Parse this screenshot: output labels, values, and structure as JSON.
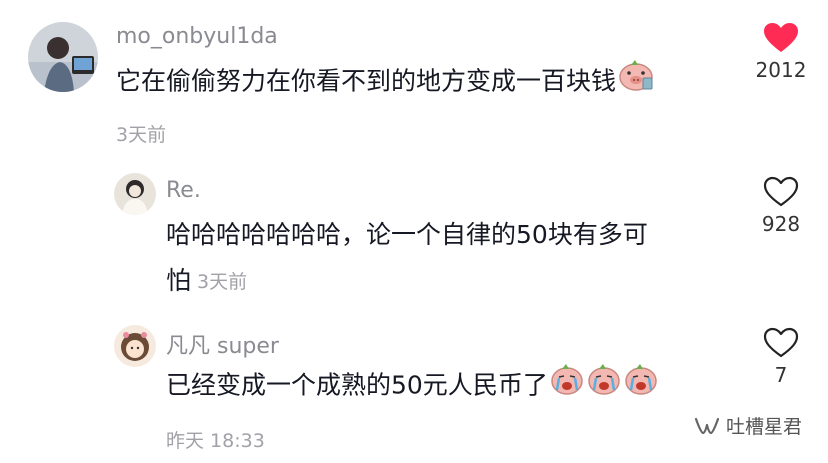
{
  "comments": [
    {
      "username": "mo_onbyul1da",
      "text": "它在偷偷努力在你看不到的地方变成一百块钱",
      "time": "3天前",
      "likes": "2012",
      "liked": true,
      "emoji": "piggy-face-icon"
    },
    {
      "username": "Re.",
      "text_line1": "哈哈哈哈哈哈哈，论一个自律的50块有多可",
      "text_line2": "怕",
      "time": "3天前",
      "likes": "928",
      "liked": false
    },
    {
      "username": "凡凡 super",
      "text": "已经变成一个成熟的50元人民币了",
      "time": "昨天 18:33",
      "likes": "7",
      "liked": false,
      "emoji": "crying-piggy-icon"
    }
  ],
  "watermark": {
    "label": "吐槽星君",
    "icon": "wechat-channel-icon"
  },
  "colors": {
    "like_red": "#fe2c55",
    "muted": "#8a8b91",
    "text": "#161823"
  }
}
